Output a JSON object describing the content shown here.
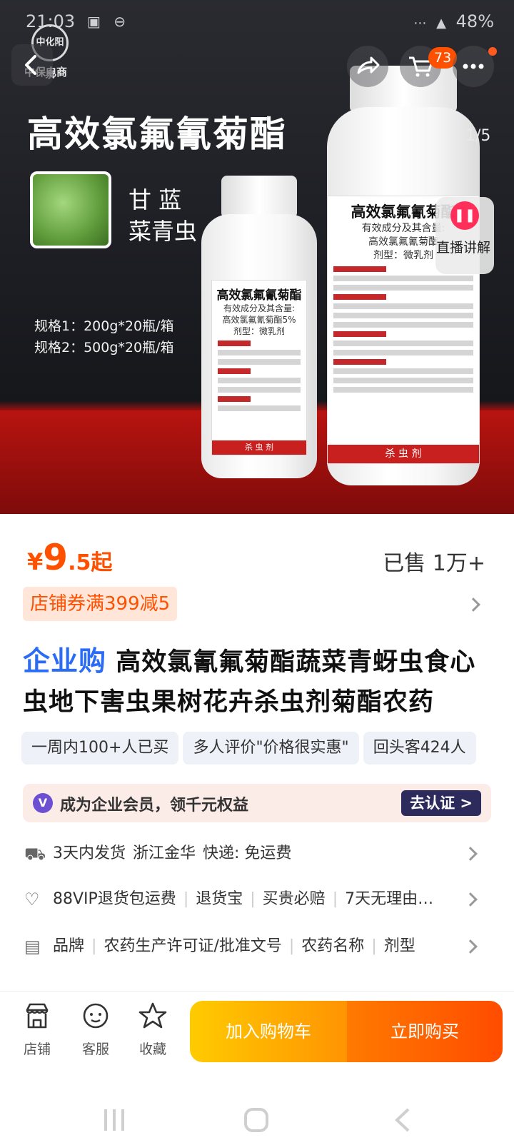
{
  "status": {
    "time": "21:03",
    "battery": "48%"
  },
  "hero": {
    "store_logo_text": "中保电商",
    "store_logo_badge": "中化阳泉",
    "cart_count": "73",
    "pager": "1/5",
    "headline": "高效氯氟氰菊酯",
    "crop_line1": "甘 蓝",
    "crop_line2": "菜青虫",
    "spec1": "规格1：200g*20瓶/箱",
    "spec2": "规格2：500g*20瓶/箱",
    "bottle_small": {
      "title": "高效氯氟氰菊酯",
      "sub1": "有效成分及其含量:",
      "sub2": "高效氯氟氰菊酯5%",
      "sub3": "剂型：微乳剂",
      "foot": "杀 虫 剂"
    },
    "bottle_large": {
      "title": "高效氯氟氰菊酯",
      "sub1": "有效成分及其含量:",
      "sub2": "高效氯氟氰菊酯",
      "sub3": "剂型：微乳剂",
      "foot": "杀 虫 剂"
    },
    "live_label": "直播讲解"
  },
  "price": {
    "symbol": "¥",
    "integer": "9",
    "decimal": ".5",
    "suffix": "起",
    "sold": "已售 1万+"
  },
  "coupon": "店铺券满399减5",
  "title": {
    "tag": "企业购",
    "text": "高效氯氰氟菊酯蔬菜青蚜虫食心虫地下害虫果树花卉杀虫剂菊酯农药"
  },
  "tags": [
    "一周内100+人已买",
    "多人评价\"价格很实惠\"",
    "回头客424人"
  ],
  "member": {
    "icon": "V",
    "text": "成为企业会员，领千元权益",
    "button": "去认证 >"
  },
  "shipping": [
    "3天内发货",
    "浙江金华",
    "快递: 免运费"
  ],
  "service": [
    "88VIP退货包运费",
    "退货宝",
    "买贵必赔",
    "7天无理由…"
  ],
  "params": [
    "品牌",
    "农药生产许可证/批准文号",
    "农药名称",
    "剂型"
  ],
  "bottom": {
    "store": "店铺",
    "service": "客服",
    "favorite": "收藏",
    "add_cart": "加入购物车",
    "buy_now": "立即购买"
  },
  "colors": {
    "accent": "#ff5000",
    "enterprise_blue": "#2a6cf6"
  }
}
